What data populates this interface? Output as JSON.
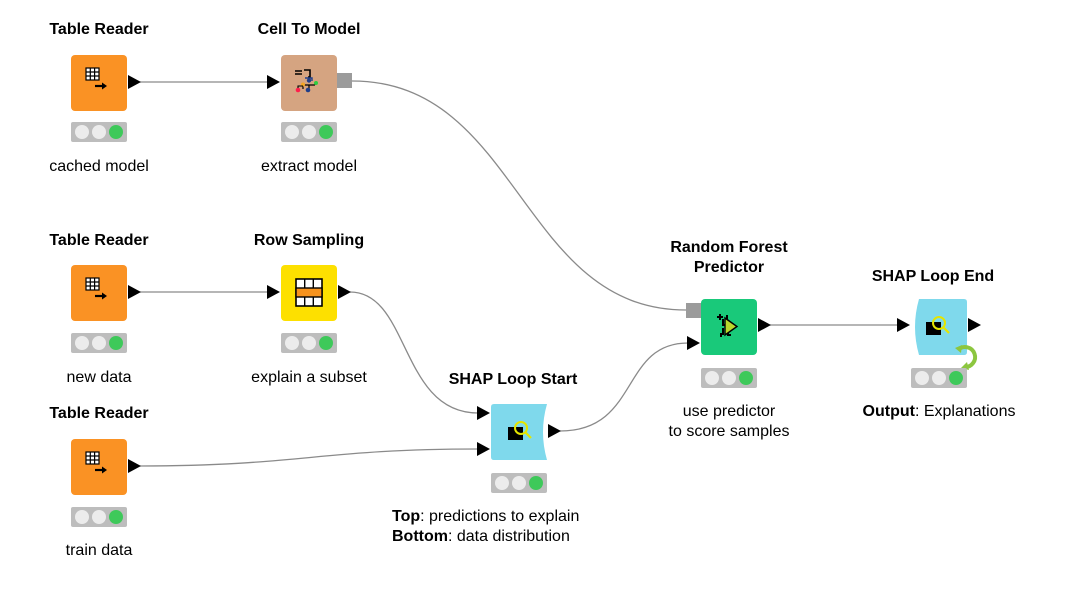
{
  "colors": {
    "table_reader": "#fa9224",
    "cell_to_model": "#d5a481",
    "row_sampling": "#fde000",
    "shap": "#7fd9ec",
    "predictor": "#19c97a",
    "status_on": "#3ec95a",
    "status_off": "#ececec",
    "status_bg": "#bdbdbd",
    "model_port": "#9b9b9b",
    "connection": "#8a8a8a"
  },
  "nodes": [
    {
      "id": "tr1",
      "title": "Table Reader",
      "label": "cached model",
      "icon": "table-reader-icon",
      "status": "executed"
    },
    {
      "id": "ctm",
      "title": "Cell To Model",
      "label": "extract model",
      "icon": "cell-to-model-icon",
      "status": "executed"
    },
    {
      "id": "tr2",
      "title": "Table Reader",
      "label": "new data",
      "icon": "table-reader-icon",
      "status": "executed"
    },
    {
      "id": "rs",
      "title": "Row Sampling",
      "label": "explain a subset",
      "icon": "row-sampling-icon",
      "status": "executed"
    },
    {
      "id": "tr3",
      "title": "Table Reader",
      "label": "train data",
      "icon": "table-reader-icon",
      "status": "executed"
    },
    {
      "id": "sls",
      "title": "SHAP Loop Start",
      "label_lines": [
        {
          "bold": "Top",
          "rest": ": predictions to explain"
        },
        {
          "bold": "Bottom",
          "rest": ": data distribution"
        }
      ],
      "icon": "shap-loop-start-icon",
      "status": "executed"
    },
    {
      "id": "rfp",
      "title_lines": [
        "Random Forest",
        "Predictor"
      ],
      "label_lines": [
        "use predictor",
        "to score samples"
      ],
      "icon": "random-forest-predictor-icon",
      "status": "executed"
    },
    {
      "id": "sle",
      "title": "SHAP Loop End",
      "label_lines": [
        {
          "bold": "Output",
          "rest": ": Explanations"
        }
      ],
      "icon": "shap-loop-end-icon",
      "status": "executed"
    }
  ],
  "connections": [
    {
      "from": "tr1",
      "to": "ctm",
      "type": "data"
    },
    {
      "from": "ctm",
      "to": "rfp",
      "type": "model"
    },
    {
      "from": "tr2",
      "to": "rs",
      "type": "data"
    },
    {
      "from": "rs",
      "to": "sls",
      "to_port": "top",
      "type": "data"
    },
    {
      "from": "tr3",
      "to": "sls",
      "to_port": "bottom",
      "type": "data"
    },
    {
      "from": "sls",
      "to": "rfp",
      "to_port": "data",
      "type": "data"
    },
    {
      "from": "rfp",
      "to": "sle",
      "type": "data"
    }
  ]
}
